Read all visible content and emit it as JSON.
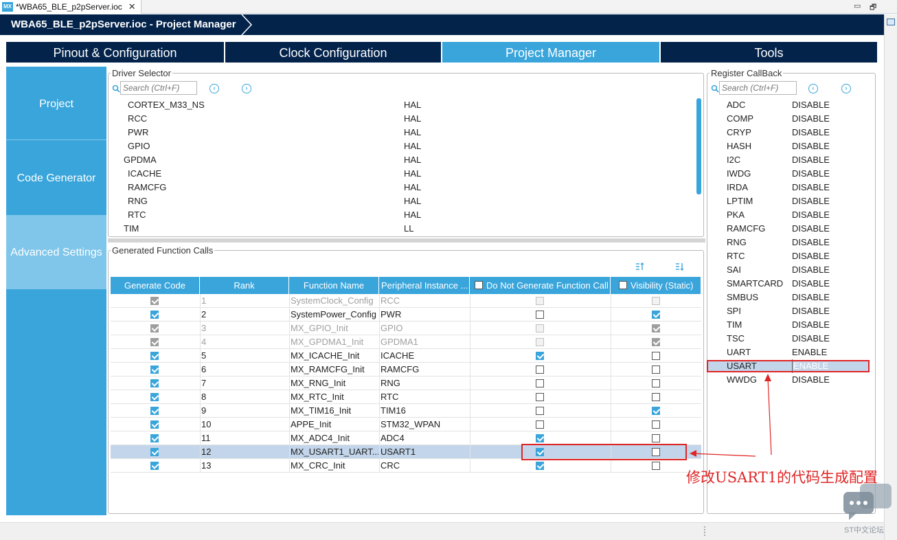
{
  "editor_tab": {
    "title": "*WBA65_BLE_p2pServer.ioc",
    "close": "✕",
    "icon_text": "MX"
  },
  "breadcrumb": {
    "title": "WBA65_BLE_p2pServer.ioc - Project Manager"
  },
  "main_tabs": [
    {
      "label": "Pinout & Configuration"
    },
    {
      "label": "Clock Configuration"
    },
    {
      "label": "Project Manager"
    },
    {
      "label": "Tools"
    }
  ],
  "left_nav": [
    {
      "label": "Project"
    },
    {
      "label": "Code Generator"
    },
    {
      "label": "Advanced Settings"
    }
  ],
  "driver_selector": {
    "title": "Driver Selector",
    "search_placeholder": "Search (Ctrl+F)",
    "rows": [
      {
        "name": "CORTEX_M33_NS",
        "driver": "HAL"
      },
      {
        "name": "RCC",
        "driver": "HAL"
      },
      {
        "name": "PWR",
        "driver": "HAL"
      },
      {
        "name": "GPIO",
        "driver": "HAL"
      },
      {
        "name": "GPDMA",
        "driver": "HAL"
      },
      {
        "name": "ICACHE",
        "driver": "HAL"
      },
      {
        "name": "RAMCFG",
        "driver": "HAL"
      },
      {
        "name": "RNG",
        "driver": "HAL"
      },
      {
        "name": "RTC",
        "driver": "HAL"
      },
      {
        "name": "TIM",
        "driver": "LL"
      }
    ]
  },
  "function_calls": {
    "title": "Generated Function Calls",
    "headers": [
      "Generate Code",
      "Rank",
      "Function Name",
      "Peripheral Instance ...",
      "Do Not Generate Function Call",
      "Visibility (Static)"
    ],
    "rows": [
      {
        "gen": true,
        "rank": "1",
        "func": "SystemClock_Config",
        "inst": "RCC",
        "nogen": false,
        "vis": false,
        "disabled": true
      },
      {
        "gen": true,
        "rank": "2",
        "func": "SystemPower_Config",
        "inst": "PWR",
        "nogen": false,
        "vis": true,
        "disabled": false
      },
      {
        "gen": true,
        "rank": "3",
        "func": "MX_GPIO_Init",
        "inst": "GPIO",
        "nogen": false,
        "vis": true,
        "disabled": true
      },
      {
        "gen": true,
        "rank": "4",
        "func": "MX_GPDMA1_Init",
        "inst": "GPDMA1",
        "nogen": false,
        "vis": true,
        "disabled": true
      },
      {
        "gen": true,
        "rank": "5",
        "func": "MX_ICACHE_Init",
        "inst": "ICACHE",
        "nogen": true,
        "vis": false,
        "disabled": false
      },
      {
        "gen": true,
        "rank": "6",
        "func": "MX_RAMCFG_Init",
        "inst": "RAMCFG",
        "nogen": false,
        "vis": false,
        "disabled": false
      },
      {
        "gen": true,
        "rank": "7",
        "func": "MX_RNG_Init",
        "inst": "RNG",
        "nogen": false,
        "vis": false,
        "disabled": false
      },
      {
        "gen": true,
        "rank": "8",
        "func": "MX_RTC_Init",
        "inst": "RTC",
        "nogen": false,
        "vis": false,
        "disabled": false
      },
      {
        "gen": true,
        "rank": "9",
        "func": "MX_TIM16_Init",
        "inst": "TIM16",
        "nogen": false,
        "vis": true,
        "disabled": false
      },
      {
        "gen": true,
        "rank": "10",
        "func": "APPE_Init",
        "inst": "STM32_WPAN",
        "nogen": false,
        "vis": false,
        "disabled": false
      },
      {
        "gen": true,
        "rank": "11",
        "func": "MX_ADC4_Init",
        "inst": "ADC4",
        "nogen": true,
        "vis": false,
        "disabled": false
      },
      {
        "gen": true,
        "rank": "12",
        "func": "MX_USART1_UART...",
        "inst": "USART1",
        "nogen": true,
        "vis": false,
        "disabled": false,
        "selected": true
      },
      {
        "gen": true,
        "rank": "13",
        "func": "MX_CRC_Init",
        "inst": "CRC",
        "nogen": true,
        "vis": false,
        "disabled": false
      }
    ]
  },
  "register_callback": {
    "title": "Register CallBack",
    "search_placeholder": "Search (Ctrl+F)",
    "rows": [
      {
        "name": "ADC",
        "value": "DISABLE"
      },
      {
        "name": "COMP",
        "value": "DISABLE"
      },
      {
        "name": "CRYP",
        "value": "DISABLE"
      },
      {
        "name": "HASH",
        "value": "DISABLE"
      },
      {
        "name": "I2C",
        "value": "DISABLE"
      },
      {
        "name": "IWDG",
        "value": "DISABLE"
      },
      {
        "name": "IRDA",
        "value": "DISABLE"
      },
      {
        "name": "LPTIM",
        "value": "DISABLE"
      },
      {
        "name": "PKA",
        "value": "DISABLE"
      },
      {
        "name": "RAMCFG",
        "value": "DISABLE"
      },
      {
        "name": "RNG",
        "value": "DISABLE"
      },
      {
        "name": "RTC",
        "value": "DISABLE"
      },
      {
        "name": "SAI",
        "value": "DISABLE"
      },
      {
        "name": "SMARTCARD",
        "value": "DISABLE"
      },
      {
        "name": "SMBUS",
        "value": "DISABLE"
      },
      {
        "name": "SPI",
        "value": "DISABLE"
      },
      {
        "name": "TIM",
        "value": "DISABLE"
      },
      {
        "name": "TSC",
        "value": "DISABLE"
      },
      {
        "name": "UART",
        "value": "ENABLE"
      },
      {
        "name": "USART",
        "value": "ENABLE",
        "selected": true
      },
      {
        "name": "WWDG",
        "value": "DISABLE"
      }
    ]
  },
  "annotation": {
    "text": "修改USART1的代码生成配置"
  },
  "watermark": {
    "text": "ST中文论坛"
  },
  "colors": {
    "accent": "#3aa5db",
    "dark": "#03234b",
    "annotation": "#e02424",
    "selection": "#c3d5ea"
  }
}
